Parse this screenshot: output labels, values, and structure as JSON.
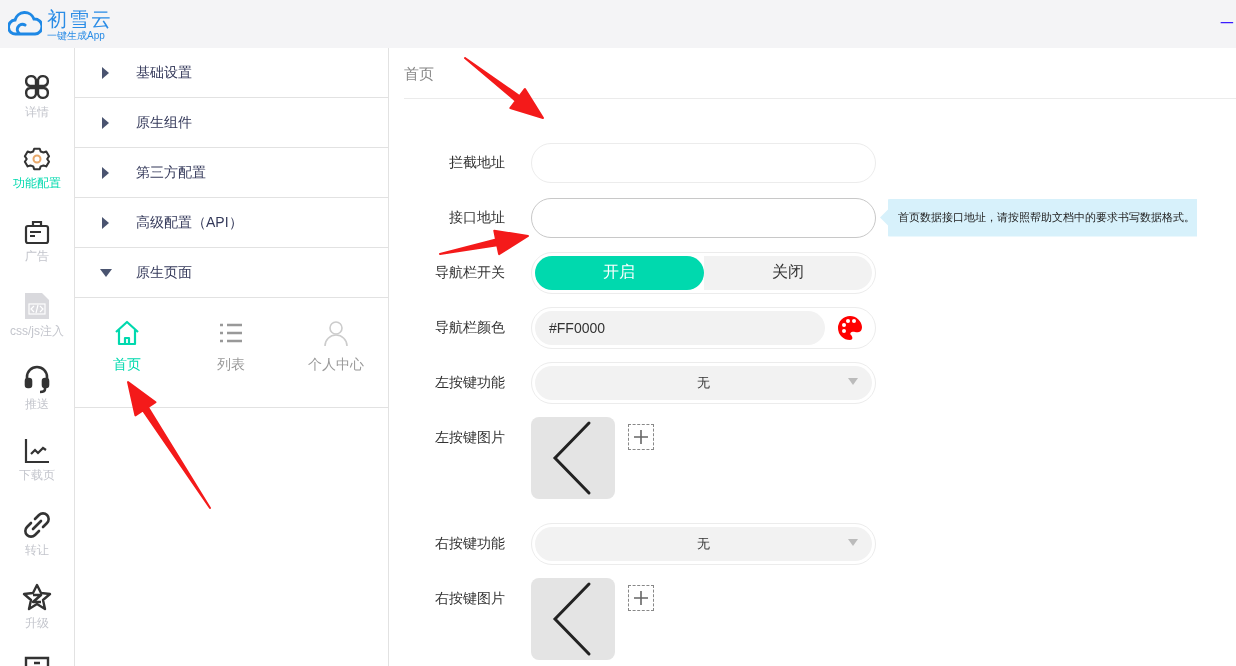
{
  "logo": {
    "name": "初雪云",
    "tagline": "一键生成App"
  },
  "header_link": "一",
  "rail": [
    {
      "label": "详情",
      "selected": false,
      "disabled": false
    },
    {
      "label": "功能配置",
      "selected": true,
      "disabled": false
    },
    {
      "label": "广告",
      "selected": false,
      "disabled": false
    },
    {
      "label": "css/js注入",
      "selected": false,
      "disabled": true
    },
    {
      "label": "推送",
      "selected": false,
      "disabled": false
    },
    {
      "label": "下载页",
      "selected": false,
      "disabled": false
    },
    {
      "label": "转让",
      "selected": false,
      "disabled": false
    },
    {
      "label": "升级",
      "selected": false,
      "disabled": false
    },
    {
      "selected": false,
      "disabled": false
    }
  ],
  "menu": [
    {
      "label": "基础设置",
      "expanded": false
    },
    {
      "label": "原生组件",
      "expanded": false
    },
    {
      "label": "第三方配置",
      "expanded": false
    },
    {
      "label": "高级配置（API）",
      "expanded": false
    },
    {
      "label": "原生页面",
      "expanded": true,
      "pages": [
        {
          "label": "首页",
          "selected": true
        },
        {
          "label": "列表",
          "selected": false
        },
        {
          "label": "个人中心",
          "selected": false
        }
      ]
    }
  ],
  "breadcrumb": "首页",
  "form": [
    {
      "kind": "input",
      "label": "拦截地址",
      "focused": false
    },
    {
      "kind": "input",
      "label": "接口地址",
      "focused": true,
      "tooltip": "首页数据接口地址，请按照帮助文档中的要求书写数据格式。"
    },
    {
      "kind": "toggle",
      "label": "导航栏开关",
      "options": [
        {
          "label": "开启",
          "selected": true
        },
        {
          "label": "关闭",
          "selected": false
        }
      ]
    },
    {
      "kind": "color",
      "label": "导航栏颜色",
      "value": "#FF0000"
    },
    {
      "kind": "select",
      "label": "左按键功能",
      "value": "无"
    },
    {
      "kind": "image",
      "label": "左按键图片"
    },
    {
      "kind": "select",
      "label": "右按键功能",
      "value": "无"
    },
    {
      "kind": "image",
      "label": "右按键图片"
    }
  ]
}
